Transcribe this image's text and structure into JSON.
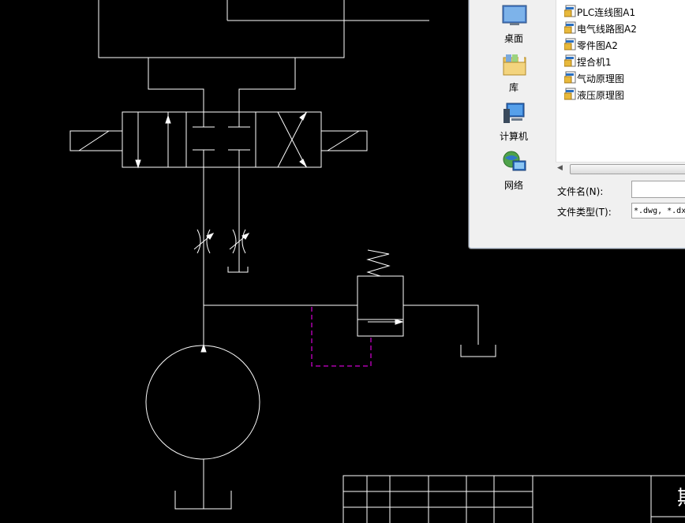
{
  "colors": {
    "canvas_background": "#000000",
    "drawing_lines": "#ffffff",
    "drain_line": "#ff00ff",
    "dialog_background": "#f0f0f0"
  },
  "file_dialog": {
    "places": [
      {
        "label": "桌面",
        "icon": "desktop-icon"
      },
      {
        "label": "库",
        "icon": "library-icon"
      },
      {
        "label": "计算机",
        "icon": "computer-icon"
      },
      {
        "label": "网络",
        "icon": "network-icon"
      }
    ],
    "files": [
      {
        "name": "PLC连线图A1",
        "icon": "dwg-file-icon"
      },
      {
        "name": "电气线路图A2",
        "icon": "dwg-file-icon"
      },
      {
        "name": "零件图A2",
        "icon": "dwg-file-icon"
      },
      {
        "name": "捏合机1",
        "icon": "dwg-file-icon"
      },
      {
        "name": "气动原理图",
        "icon": "dwg-file-icon"
      },
      {
        "name": "液压原理图",
        "icon": "dwg-file-icon"
      }
    ],
    "filename_label": "文件名(N):",
    "filename_value": "",
    "filetype_label": "文件类型(T):",
    "filetype_value": "*.dwg, *.dxf"
  },
  "title_block": {
    "visible_character": "斯"
  }
}
